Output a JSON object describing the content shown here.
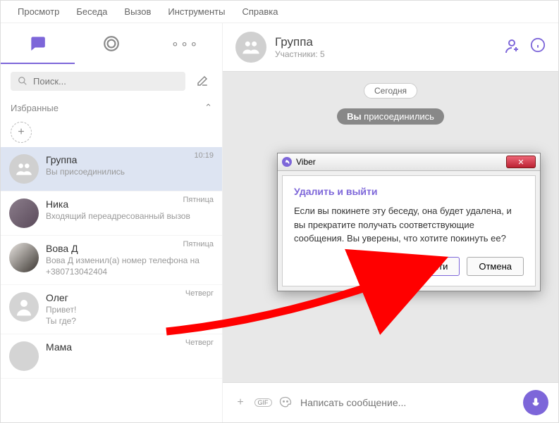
{
  "menubar": [
    "Просмотр",
    "Беседа",
    "Вызов",
    "Инструменты",
    "Справка"
  ],
  "search": {
    "placeholder": "Поиск..."
  },
  "favorites": {
    "label": "Избранные"
  },
  "chats": [
    {
      "name": "Группа",
      "preview": "Вы присоединились",
      "time": "10:19",
      "selected": true,
      "avatar": "group"
    },
    {
      "name": "Ника",
      "preview": "Входящий переадресованный вызов",
      "time": "Пятница",
      "avatar": "ph1"
    },
    {
      "name": "Вова Д",
      "preview": "Вова Д изменил(а) номер телефона на +380713042404",
      "time": "Пятница",
      "avatar": "ph2"
    },
    {
      "name": "Олег",
      "preview": "Привет!\nТы где?",
      "time": "Четверг",
      "avatar": "blank"
    },
    {
      "name": "Мама",
      "preview": "",
      "time": "Четверг",
      "avatar": "blank"
    }
  ],
  "header": {
    "title": "Группа",
    "subtitle": "Участники: 5"
  },
  "messages": {
    "date": "Сегодня",
    "joined_prefix": "Вы",
    "joined_suffix": " присоединились"
  },
  "composer": {
    "placeholder": "Написать сообщение..."
  },
  "dialog": {
    "app": "Viber",
    "heading": "Удалить и выйти",
    "text": "Если вы покинете эту беседу, она будет удалена, и вы прекратите получать соответствующие сообщения. Вы уверены, что хотите покинуть ее?",
    "primary": "Выйти",
    "secondary": "Отмена"
  }
}
